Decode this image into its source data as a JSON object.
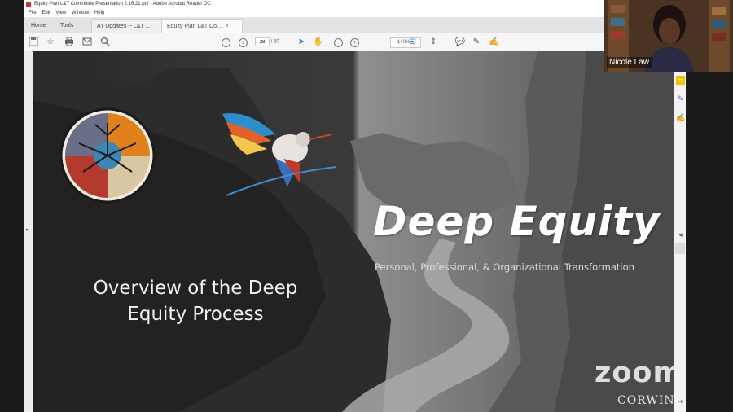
{
  "window": {
    "title": "Equity Plan L&T Committee Presentation 2.16.21.pdf - Adobe Acrobat Reader DC"
  },
  "menu": [
    "File",
    "Edit",
    "View",
    "Window",
    "Help"
  ],
  "tabs": {
    "home": "Home",
    "tools": "Tools",
    "doc_tabs": [
      {
        "label": "AT Updates -- L&T ...",
        "active": false
      },
      {
        "label": "Equity Plan L&T Co...",
        "active": true
      }
    ],
    "close_glyph": "×"
  },
  "toolbar": {
    "page_current": "28",
    "page_total": "/ 50",
    "zoom": "140%"
  },
  "slide": {
    "title": "Deep Equity",
    "subtitle": "Personal, Professional, & Organizational Transformation",
    "overview_line1": "Overview of the Deep",
    "overview_line2": "Equity Process",
    "watermark": "zoom",
    "publisher": "CORWIN"
  },
  "webcam": {
    "participant_name": "Nicole Law"
  },
  "icons": {
    "save": "save-icon",
    "bookmark": "star-icon",
    "print": "print-icon",
    "email": "mail-icon",
    "search": "search-icon"
  },
  "colors": {
    "accent": "#2d6ee0",
    "comment": "#f2c200",
    "highlight": "#9b59b6"
  }
}
